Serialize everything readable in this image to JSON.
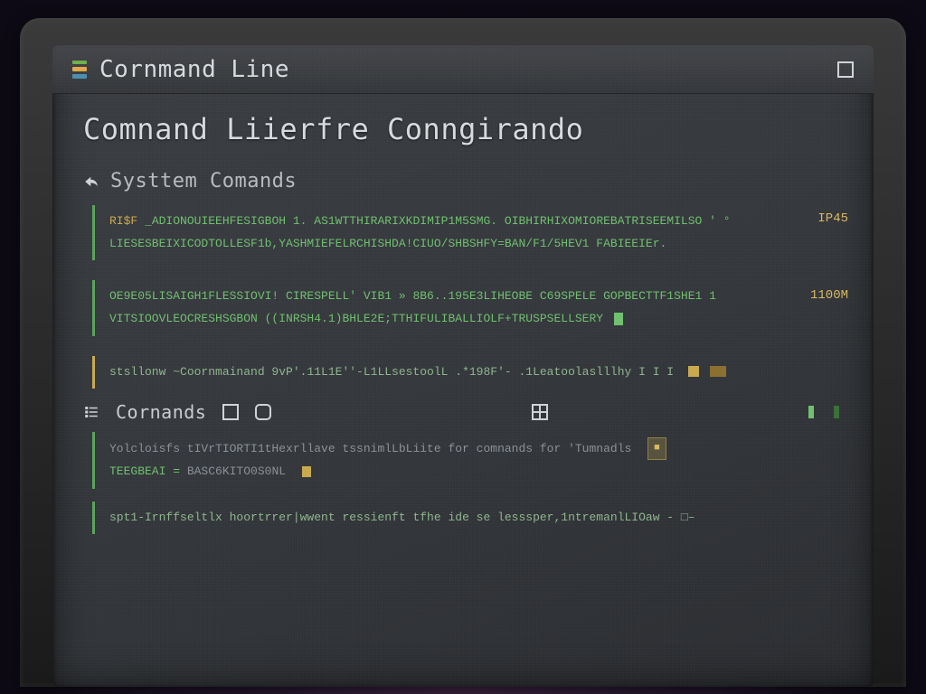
{
  "window": {
    "title": "Cornmand Line"
  },
  "page": {
    "heading": "Comnand Liierfre Conngirando"
  },
  "sections": {
    "system": {
      "title": "Systtem Comands",
      "block1": {
        "line1_a": "RI$F",
        "line1_b": "_ADIONOUIEEHFESIGBOH 1. AS1WTTHIRARIXKDIMIP1M5SMG. OIBHIRHIXOMIOREBATRISEEMILSO ' °",
        "line2": "LIESESBEIXICODTOLLESF1b,YASHMIEFELRCHISHDA!CIUO/SHBSHFY=BAN/F1/5HEV1 FABIEEIEr.",
        "side_tag": "IP45"
      },
      "block2": {
        "line1": "OE9E05LISAIGH1FLESSIOVI! CIRESPELL' VIB1 » 8B6..195E3LIHEOBE C69SPELE GOPBECTTF1SHE1 1",
        "line2": "VITSIOOVLEOCRESHSGBON ((INRSH4.1)BHLE2E;TTHIFULIBALLIOLF+TRUSPSELLSERY",
        "side_num": "1100M",
        "cursor": true
      },
      "prompt": {
        "text": "stsllonw  ~Coornmainand 9vP'.11L1E''-L1LLsestoolL .*198F'- .1Leatoolaslllhy I I I",
        "chips": true
      }
    },
    "commands": {
      "title": "Cornands",
      "desc": {
        "line1_a": "Yolcloisfs tIVrTIORTI1tHexrllave tssnimlLbLiite for comnands for 'Tumnadls",
        "line1_badge": "■",
        "line2_a": "TEEGBEAI =",
        "line2_b": "BASC6KITO0S0NL",
        "line2_chip": true
      },
      "prompt2": "spt1-Irnffseltlx hoortrrer|wwent ressienft tfhe ide se lesssper,1ntremanlLIOaw - □–"
    }
  },
  "colors": {
    "term_green": "#6fbf6f",
    "term_amber": "#d8b860",
    "panel_bg": "#34373b"
  }
}
